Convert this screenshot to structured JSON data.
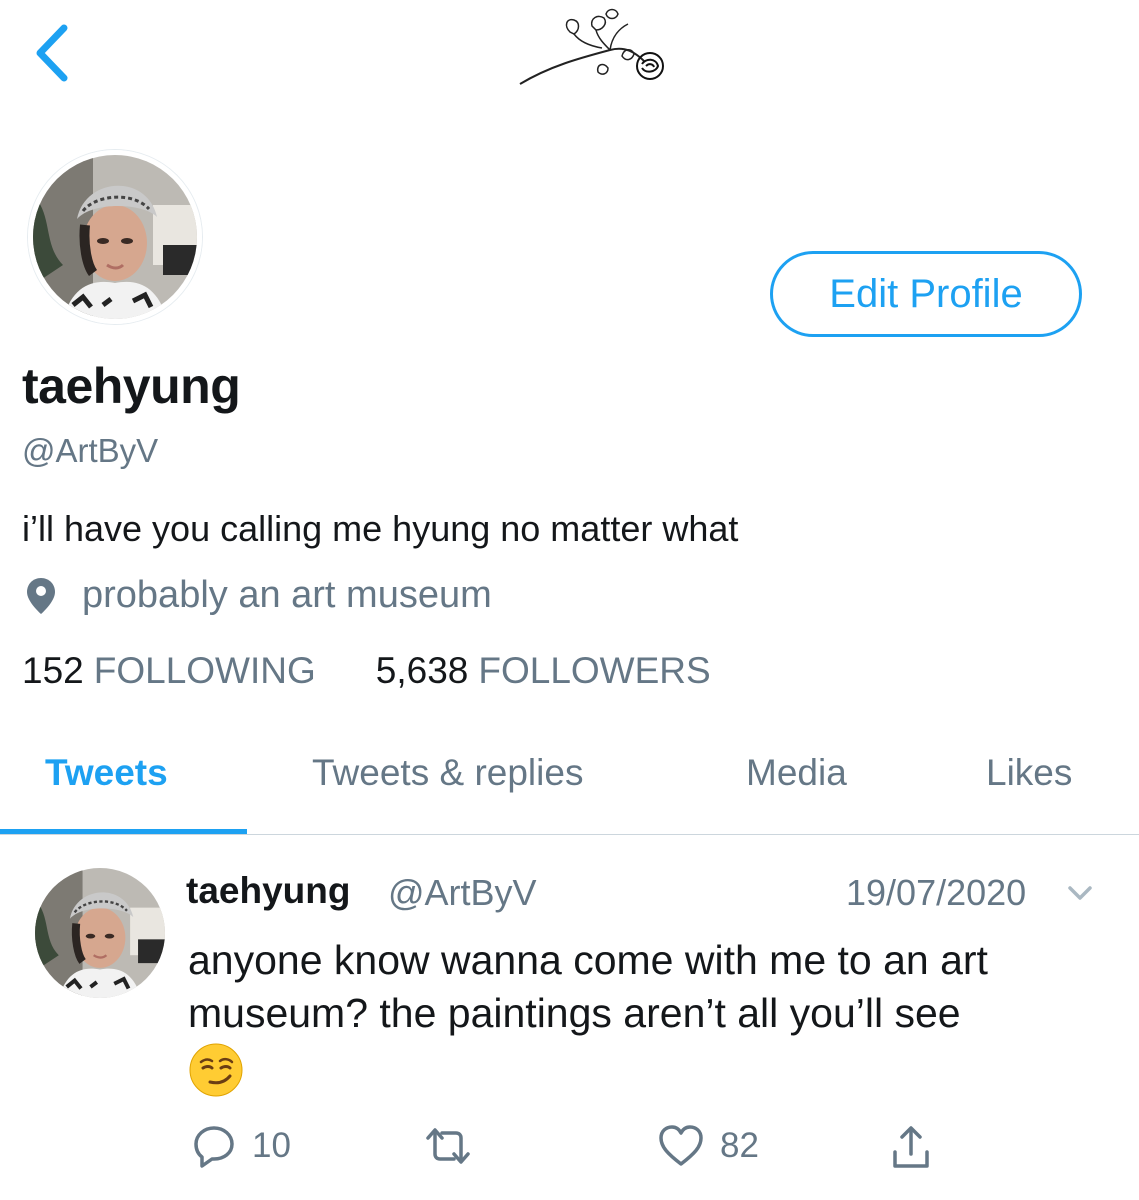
{
  "header": {
    "back_icon": "chevron-left-icon",
    "decoration": "rose-sketch"
  },
  "profile": {
    "display_name": "taehyung",
    "handle": "@ArtByV",
    "bio": "i’ll have you calling me hyung no matter what",
    "location": "probably an art museum",
    "edit_button": "Edit Profile",
    "following_count": "152",
    "following_label": "FOLLOWING",
    "followers_count": "5,638",
    "followers_label": "FOLLOWERS"
  },
  "tabs": [
    {
      "label": "Tweets",
      "active": true
    },
    {
      "label": "Tweets & replies",
      "active": false
    },
    {
      "label": "Media",
      "active": false
    },
    {
      "label": "Likes",
      "active": false
    }
  ],
  "tweet": {
    "name": "taehyung",
    "handle": "@ArtByV",
    "date": "19/07/2020",
    "text": "anyone know wanna come with me to an art museum? the paintings aren’t all you’ll see",
    "emoji": "smirking-face",
    "replies": "10",
    "likes": "82"
  },
  "colors": {
    "accent": "#1da1f2",
    "secondary_text": "#657786",
    "primary_text": "#14171a"
  }
}
